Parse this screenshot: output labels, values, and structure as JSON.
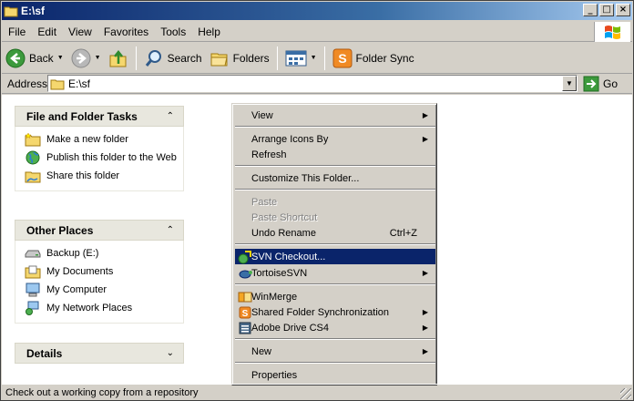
{
  "window": {
    "title": "E:\\sf"
  },
  "menubar": {
    "items": [
      "File",
      "Edit",
      "View",
      "Favorites",
      "Tools",
      "Help"
    ]
  },
  "toolbar": {
    "back_label": "Back",
    "search_label": "Search",
    "folders_label": "Folders",
    "folder_sync_label": "Folder Sync"
  },
  "address": {
    "label": "Address",
    "value": "E:\\sf",
    "go_label": "Go"
  },
  "panels": {
    "tasks": {
      "title": "File and Folder Tasks",
      "items": [
        "Make a new folder",
        "Publish this folder to the Web",
        "Share this folder"
      ]
    },
    "places": {
      "title": "Other Places",
      "items": [
        "Backup (E:)",
        "My Documents",
        "My Computer",
        "My Network Places"
      ]
    },
    "details": {
      "title": "Details"
    }
  },
  "context_menu": {
    "view": "View",
    "arrange": "Arrange Icons By",
    "refresh": "Refresh",
    "customize": "Customize This Folder...",
    "paste": "Paste",
    "paste_shortcut": "Paste Shortcut",
    "undo": "Undo Rename",
    "undo_shortcut": "Ctrl+Z",
    "svn_checkout": "SVN Checkout...",
    "tortoise": "TortoiseSVN",
    "winmerge": "WinMerge",
    "shared_sync": "Shared Folder Synchronization",
    "adobe_drive": "Adobe Drive CS4",
    "new": "New",
    "properties": "Properties"
  },
  "status": {
    "text": "Check out a working copy from a repository"
  },
  "icons": {
    "folder": "folder-icon",
    "back": "back-arrow-icon",
    "forward": "forward-arrow-icon",
    "up": "up-folder-icon",
    "search": "search-icon",
    "views": "views-icon",
    "sync": "folder-sync-icon",
    "go": "go-arrow-icon",
    "windows": "windows-logo-icon"
  },
  "colors": {
    "title_bar": "#0a246a",
    "menu_highlight": "#0a246a",
    "window_bg": "#d4d0c8",
    "panel_header": "#e8e7de"
  }
}
